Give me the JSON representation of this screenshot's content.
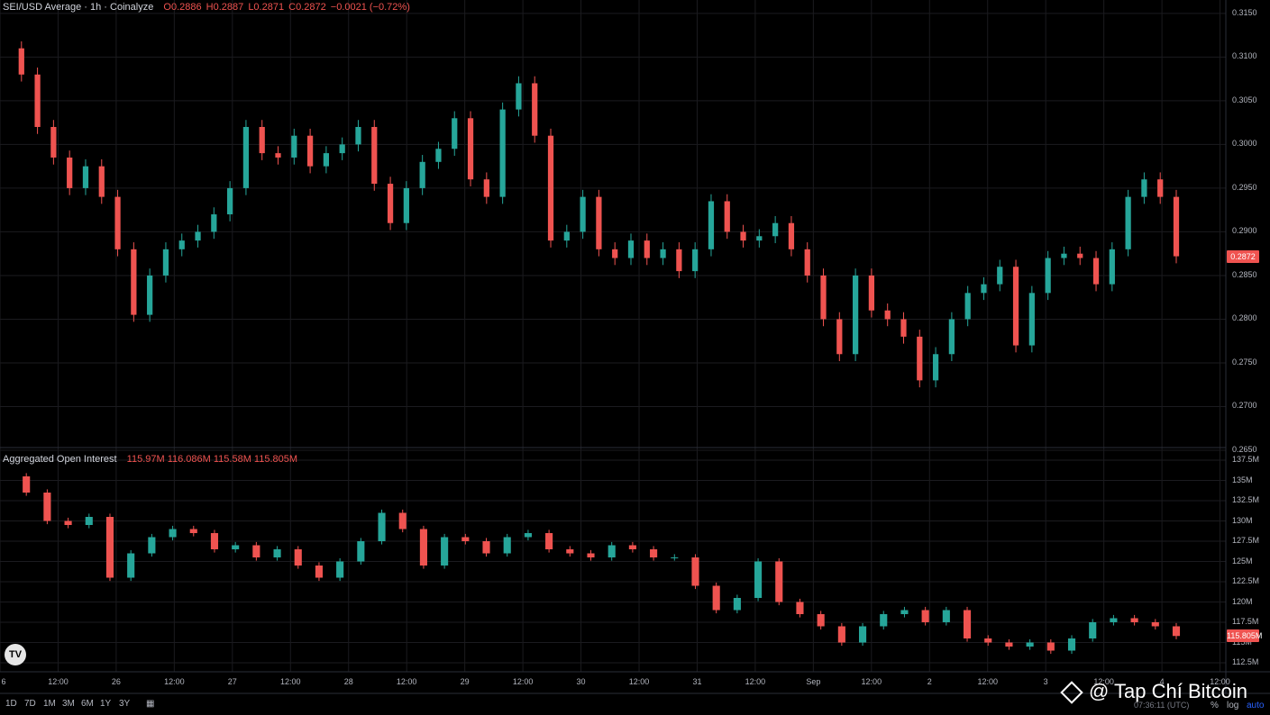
{
  "legend_top": {
    "symbol": "SEI/USD Average · 1h · Coinalyze",
    "o": "O0.2886",
    "h": "H0.2887",
    "l": "L0.2871",
    "c": "C0.2872",
    "chg": "−0.0021 (−0.72%)"
  },
  "legend_oi": {
    "title": "Aggregated Open Interest",
    "values": "115.97M  116.086M  115.58M  115.805M"
  },
  "price_tag": "0.2872",
  "oi_tag": "115.805M",
  "timeframes": [
    "1D",
    "7D",
    "1M",
    "3M",
    "6M",
    "1Y",
    "3Y"
  ],
  "controls": {
    "percent": "%",
    "log": "log",
    "auto": "auto"
  },
  "clock": "07:36:11 (UTC)",
  "watermark": "@ Tap Chí Bitcoin",
  "tv_logo": "TV",
  "colors": {
    "up": "#26a69a",
    "down": "#ef5350",
    "bg": "#000000",
    "grid": "#1b1b1f"
  },
  "chart_data": [
    {
      "type": "candlestick",
      "title": "SEI/USD Average · 1h · Coinalyze",
      "yticks": [
        "0.3150",
        "0.3100",
        "0.3050",
        "0.3000",
        "0.2950",
        "0.2900",
        "0.2850",
        "0.2800",
        "0.2750",
        "0.2700",
        "0.2650"
      ],
      "ylim": [
        0.265,
        0.3155
      ],
      "xticks": [
        "6",
        "12:00",
        "26",
        "12:00",
        "27",
        "12:00",
        "28",
        "12:00",
        "29",
        "12:00",
        "30",
        "12:00",
        "31",
        "12:00",
        "Sep",
        "12:00",
        "2",
        "12:00",
        "3",
        "12:00",
        "4",
        "12:00"
      ],
      "close_series": [
        0.311,
        0.308,
        0.302,
        0.2985,
        0.295,
        0.2975,
        0.294,
        0.288,
        0.2805,
        0.285,
        0.288,
        0.289,
        0.29,
        0.292,
        0.295,
        0.302,
        0.299,
        0.2985,
        0.301,
        0.2975,
        0.299,
        0.3,
        0.302,
        0.2955,
        0.291,
        0.295,
        0.298,
        0.2995,
        0.303,
        0.296,
        0.294,
        0.304,
        0.307,
        0.301,
        0.289,
        0.29,
        0.294,
        0.288,
        0.287,
        0.289,
        0.287,
        0.288,
        0.2855,
        0.288,
        0.2935,
        0.29,
        0.289,
        0.2895,
        0.291,
        0.288,
        0.285,
        0.28,
        0.276,
        0.285,
        0.281,
        0.28,
        0.278,
        0.273,
        0.276,
        0.28,
        0.283,
        0.284,
        0.286,
        0.277,
        0.283,
        0.287,
        0.2875,
        0.287,
        0.284,
        0.288,
        0.294,
        0.296,
        0.294,
        0.2872
      ]
    },
    {
      "type": "candlestick",
      "title": "Aggregated Open Interest",
      "yticks": [
        "137.5M",
        "135M",
        "132.5M",
        "130M",
        "127.5M",
        "125M",
        "122.5M",
        "120M",
        "117.5M",
        "115M",
        "112.5M"
      ],
      "ylim": [
        111.5,
        138.5
      ],
      "close_series": [
        135.5,
        133.5,
        130.0,
        129.5,
        130.5,
        123.0,
        126.0,
        128.0,
        129.0,
        128.5,
        126.5,
        127.0,
        125.5,
        126.5,
        124.5,
        123.0,
        125.0,
        127.5,
        131.0,
        129.0,
        124.5,
        128.0,
        127.5,
        126.0,
        128.0,
        128.5,
        126.5,
        126.0,
        125.5,
        127.0,
        126.5,
        125.5,
        125.5,
        122.0,
        119.0,
        120.5,
        125.0,
        120.0,
        118.5,
        117.0,
        115.0,
        117.0,
        118.5,
        119.0,
        117.5,
        119.0,
        115.5,
        115.0,
        114.5,
        115.0,
        114.0,
        115.5,
        117.5,
        118.0,
        117.5,
        117.0,
        115.805
      ]
    }
  ]
}
